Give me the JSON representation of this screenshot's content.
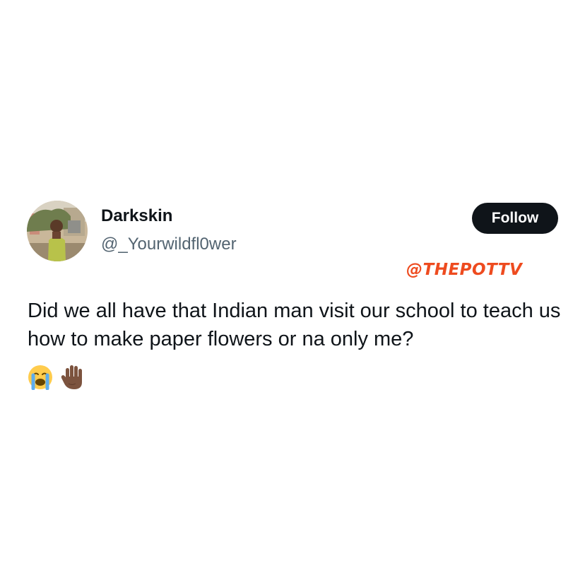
{
  "tweet": {
    "author": {
      "display_name": "Darkskin",
      "handle": "@_Yourwildfl0wer",
      "avatar": "profile-photo"
    },
    "follow_label": "Follow",
    "watermark": "@THEPOTTV",
    "text": "Did we all have that Indian man visit our school to teach us how to make paper flowers or na only me?",
    "emojis": [
      "loudly-crying-face-icon",
      "raised-hand-icon"
    ]
  },
  "colors": {
    "background": "#ffffff",
    "text": "#0f1419",
    "secondary_text": "#536471",
    "follow_button_bg": "#0f1419",
    "watermark": "#ee4b1f"
  }
}
